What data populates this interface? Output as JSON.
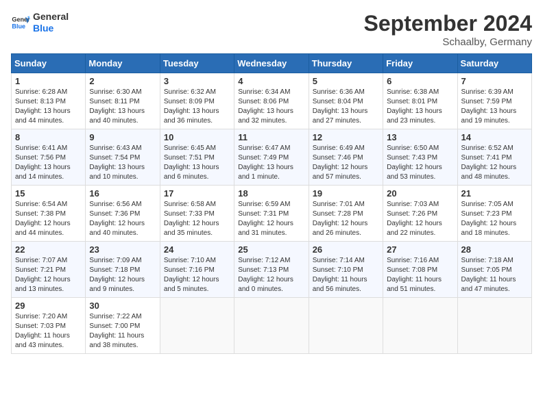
{
  "header": {
    "logo_line1": "General",
    "logo_line2": "Blue",
    "month": "September 2024",
    "location": "Schaalby, Germany"
  },
  "weekdays": [
    "Sunday",
    "Monday",
    "Tuesday",
    "Wednesday",
    "Thursday",
    "Friday",
    "Saturday"
  ],
  "weeks": [
    [
      {
        "day": "1",
        "sunrise": "Sunrise: 6:28 AM",
        "sunset": "Sunset: 8:13 PM",
        "daylight": "Daylight: 13 hours and 44 minutes."
      },
      {
        "day": "2",
        "sunrise": "Sunrise: 6:30 AM",
        "sunset": "Sunset: 8:11 PM",
        "daylight": "Daylight: 13 hours and 40 minutes."
      },
      {
        "day": "3",
        "sunrise": "Sunrise: 6:32 AM",
        "sunset": "Sunset: 8:09 PM",
        "daylight": "Daylight: 13 hours and 36 minutes."
      },
      {
        "day": "4",
        "sunrise": "Sunrise: 6:34 AM",
        "sunset": "Sunset: 8:06 PM",
        "daylight": "Daylight: 13 hours and 32 minutes."
      },
      {
        "day": "5",
        "sunrise": "Sunrise: 6:36 AM",
        "sunset": "Sunset: 8:04 PM",
        "daylight": "Daylight: 13 hours and 27 minutes."
      },
      {
        "day": "6",
        "sunrise": "Sunrise: 6:38 AM",
        "sunset": "Sunset: 8:01 PM",
        "daylight": "Daylight: 13 hours and 23 minutes."
      },
      {
        "day": "7",
        "sunrise": "Sunrise: 6:39 AM",
        "sunset": "Sunset: 7:59 PM",
        "daylight": "Daylight: 13 hours and 19 minutes."
      }
    ],
    [
      {
        "day": "8",
        "sunrise": "Sunrise: 6:41 AM",
        "sunset": "Sunset: 7:56 PM",
        "daylight": "Daylight: 13 hours and 14 minutes."
      },
      {
        "day": "9",
        "sunrise": "Sunrise: 6:43 AM",
        "sunset": "Sunset: 7:54 PM",
        "daylight": "Daylight: 13 hours and 10 minutes."
      },
      {
        "day": "10",
        "sunrise": "Sunrise: 6:45 AM",
        "sunset": "Sunset: 7:51 PM",
        "daylight": "Daylight: 13 hours and 6 minutes."
      },
      {
        "day": "11",
        "sunrise": "Sunrise: 6:47 AM",
        "sunset": "Sunset: 7:49 PM",
        "daylight": "Daylight: 13 hours and 1 minute."
      },
      {
        "day": "12",
        "sunrise": "Sunrise: 6:49 AM",
        "sunset": "Sunset: 7:46 PM",
        "daylight": "Daylight: 12 hours and 57 minutes."
      },
      {
        "day": "13",
        "sunrise": "Sunrise: 6:50 AM",
        "sunset": "Sunset: 7:43 PM",
        "daylight": "Daylight: 12 hours and 53 minutes."
      },
      {
        "day": "14",
        "sunrise": "Sunrise: 6:52 AM",
        "sunset": "Sunset: 7:41 PM",
        "daylight": "Daylight: 12 hours and 48 minutes."
      }
    ],
    [
      {
        "day": "15",
        "sunrise": "Sunrise: 6:54 AM",
        "sunset": "Sunset: 7:38 PM",
        "daylight": "Daylight: 12 hours and 44 minutes."
      },
      {
        "day": "16",
        "sunrise": "Sunrise: 6:56 AM",
        "sunset": "Sunset: 7:36 PM",
        "daylight": "Daylight: 12 hours and 40 minutes."
      },
      {
        "day": "17",
        "sunrise": "Sunrise: 6:58 AM",
        "sunset": "Sunset: 7:33 PM",
        "daylight": "Daylight: 12 hours and 35 minutes."
      },
      {
        "day": "18",
        "sunrise": "Sunrise: 6:59 AM",
        "sunset": "Sunset: 7:31 PM",
        "daylight": "Daylight: 12 hours and 31 minutes."
      },
      {
        "day": "19",
        "sunrise": "Sunrise: 7:01 AM",
        "sunset": "Sunset: 7:28 PM",
        "daylight": "Daylight: 12 hours and 26 minutes."
      },
      {
        "day": "20",
        "sunrise": "Sunrise: 7:03 AM",
        "sunset": "Sunset: 7:26 PM",
        "daylight": "Daylight: 12 hours and 22 minutes."
      },
      {
        "day": "21",
        "sunrise": "Sunrise: 7:05 AM",
        "sunset": "Sunset: 7:23 PM",
        "daylight": "Daylight: 12 hours and 18 minutes."
      }
    ],
    [
      {
        "day": "22",
        "sunrise": "Sunrise: 7:07 AM",
        "sunset": "Sunset: 7:21 PM",
        "daylight": "Daylight: 12 hours and 13 minutes."
      },
      {
        "day": "23",
        "sunrise": "Sunrise: 7:09 AM",
        "sunset": "Sunset: 7:18 PM",
        "daylight": "Daylight: 12 hours and 9 minutes."
      },
      {
        "day": "24",
        "sunrise": "Sunrise: 7:10 AM",
        "sunset": "Sunset: 7:16 PM",
        "daylight": "Daylight: 12 hours and 5 minutes."
      },
      {
        "day": "25",
        "sunrise": "Sunrise: 7:12 AM",
        "sunset": "Sunset: 7:13 PM",
        "daylight": "Daylight: 12 hours and 0 minutes."
      },
      {
        "day": "26",
        "sunrise": "Sunrise: 7:14 AM",
        "sunset": "Sunset: 7:10 PM",
        "daylight": "Daylight: 11 hours and 56 minutes."
      },
      {
        "day": "27",
        "sunrise": "Sunrise: 7:16 AM",
        "sunset": "Sunset: 7:08 PM",
        "daylight": "Daylight: 11 hours and 51 minutes."
      },
      {
        "day": "28",
        "sunrise": "Sunrise: 7:18 AM",
        "sunset": "Sunset: 7:05 PM",
        "daylight": "Daylight: 11 hours and 47 minutes."
      }
    ],
    [
      {
        "day": "29",
        "sunrise": "Sunrise: 7:20 AM",
        "sunset": "Sunset: 7:03 PM",
        "daylight": "Daylight: 11 hours and 43 minutes."
      },
      {
        "day": "30",
        "sunrise": "Sunrise: 7:22 AM",
        "sunset": "Sunset: 7:00 PM",
        "daylight": "Daylight: 11 hours and 38 minutes."
      },
      null,
      null,
      null,
      null,
      null
    ]
  ]
}
